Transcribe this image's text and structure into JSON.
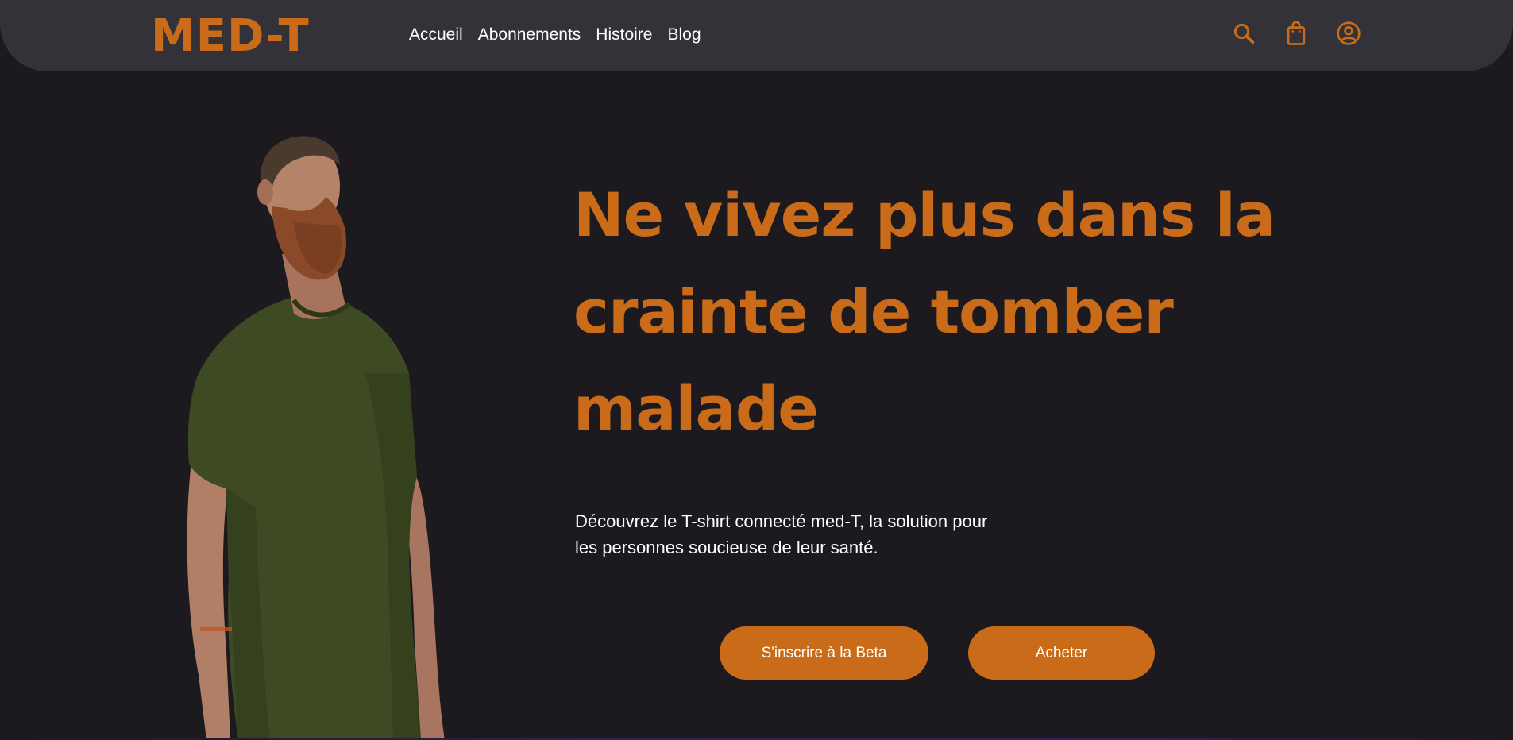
{
  "brand": {
    "logo_text": "MED-T",
    "accent_color": "#c96b18",
    "background_color": "#1c1a1f",
    "navbar_color": "#333238"
  },
  "nav": {
    "links": [
      {
        "label": "Accueil"
      },
      {
        "label": "Abonnements"
      },
      {
        "label": "Histoire"
      },
      {
        "label": "Blog"
      }
    ],
    "icons": [
      "search-icon",
      "shopping-bag-icon",
      "user-account-icon"
    ]
  },
  "hero": {
    "headline": "Ne vivez plus dans la crainte de tomber malade",
    "subtext": "Découvrez le T-shirt connecté med-T, la solution pour les personnes soucieuse de leur santé.",
    "buttons": {
      "beta": "S'inscrire à la Beta",
      "buy": "Acheter"
    }
  }
}
